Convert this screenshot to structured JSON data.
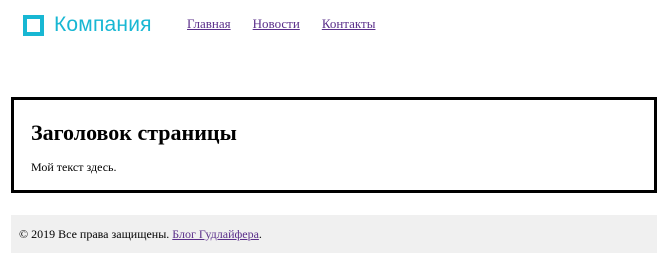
{
  "brand": {
    "name": "Компания",
    "color": "#18b7d3"
  },
  "nav": {
    "items": [
      {
        "label": "Главная"
      },
      {
        "label": "Новости"
      },
      {
        "label": "Контакты"
      }
    ],
    "link_color": "#5a2e8a"
  },
  "main": {
    "title": "Заголовок страницы",
    "text": "Мой текст здесь."
  },
  "footer": {
    "copyright": "© 2019 Все права защищены.",
    "link_label": "Блог Гудлайфера",
    "trailing": ".",
    "background": "#f0f0f0"
  }
}
